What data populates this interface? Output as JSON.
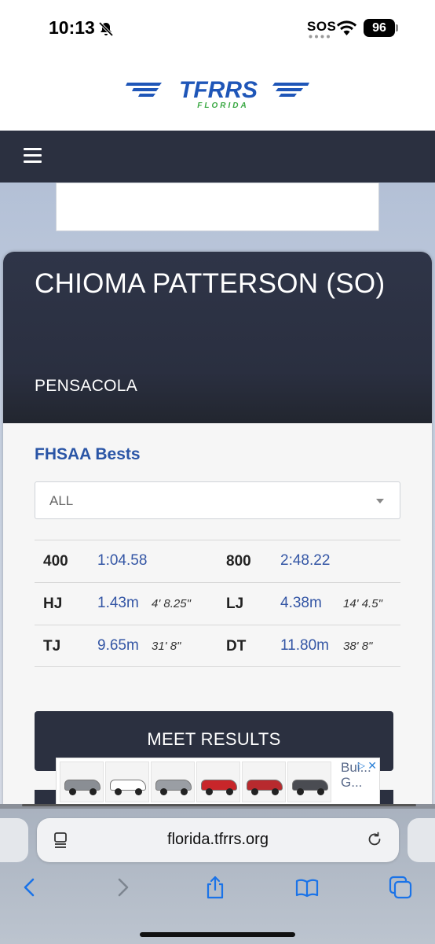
{
  "status_bar": {
    "time": "10:13",
    "sos": "SOS",
    "battery": "96"
  },
  "logo": {
    "text": "TFRRS",
    "subtext": "FLORIDA"
  },
  "athlete": {
    "name": "CHIOMA PATTERSON (SO)",
    "team": "PENSACOLA"
  },
  "bests": {
    "title": "FHSAA Bests",
    "filter": "ALL",
    "rows": [
      {
        "event1": "400",
        "mark1": "1:04.58",
        "conv1": "",
        "event2": "800",
        "mark2": "2:48.22",
        "conv2": ""
      },
      {
        "event1": "HJ",
        "mark1": "1.43m",
        "conv1": "4' 8.25\"",
        "event2": "LJ",
        "mark2": "4.38m",
        "conv2": "14' 4.5\""
      },
      {
        "event1": "TJ",
        "mark1": "9.65m",
        "conv1": "31' 8\"",
        "event2": "DT",
        "mark2": "11.80m",
        "conv2": "38' 8\""
      }
    ]
  },
  "meet_results_label": "MEET RESULTS",
  "ad": {
    "text": "Bui... G...",
    "cars": [
      "#8a8e94",
      "#ffffff",
      "#9a9ea4",
      "#c8262a",
      "#b82a2e",
      "#4a4c52"
    ]
  },
  "browser": {
    "url": "florida.tfrrs.org"
  },
  "colors": {
    "nav": "#2b3040",
    "accent": "#2a55a6",
    "link": "#3456a5",
    "ios_blue": "#1a73e8"
  }
}
